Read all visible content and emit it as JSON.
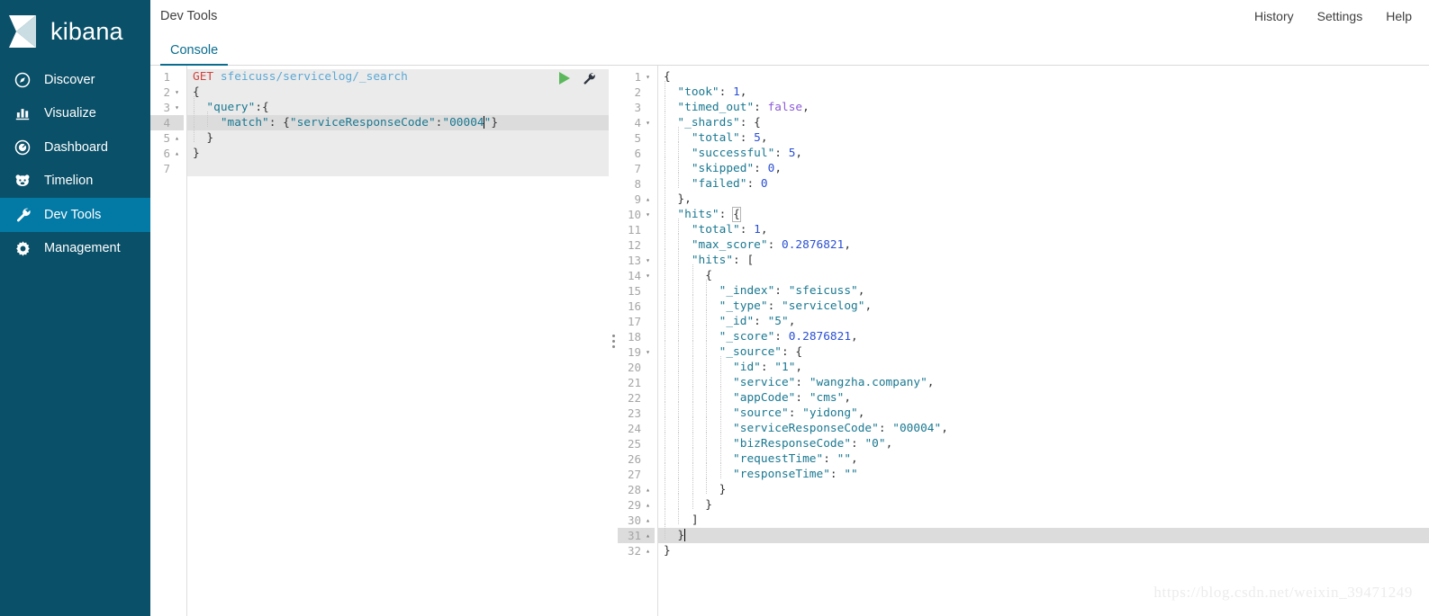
{
  "sidebar": {
    "brand": {
      "name": "kibana",
      "icon": "kibana-logo-icon"
    },
    "items": [
      {
        "label": "Discover",
        "icon": "compass-icon",
        "active": false
      },
      {
        "label": "Visualize",
        "icon": "bar-chart-icon",
        "active": false
      },
      {
        "label": "Dashboard",
        "icon": "gauge-icon",
        "active": false
      },
      {
        "label": "Timelion",
        "icon": "bear-icon",
        "active": false
      },
      {
        "label": "Dev Tools",
        "icon": "wrench-icon",
        "active": true
      },
      {
        "label": "Management",
        "icon": "gear-icon",
        "active": false
      }
    ]
  },
  "header": {
    "title": "Dev Tools",
    "links": [
      "History",
      "Settings",
      "Help"
    ]
  },
  "tabs": [
    {
      "label": "Console",
      "active": true
    }
  ],
  "request_editor": {
    "run_button": "run-request-play-icon",
    "wrench_button": "request-options-wrench-icon",
    "active_line": 4,
    "line_count": 7,
    "lines": [
      {
        "n": 1,
        "fold": "none",
        "tokens": [
          {
            "t": "GET ",
            "c": "tok-method"
          },
          {
            "t": "sfeicuss/servicelog/_search",
            "c": "tok-url"
          }
        ]
      },
      {
        "n": 2,
        "fold": "down",
        "tokens": [
          {
            "t": "{",
            "c": "tok-punct"
          }
        ]
      },
      {
        "n": 3,
        "fold": "down",
        "tokens": [
          {
            "t": "  \"query\"",
            "c": "tok-key"
          },
          {
            "t": ":{",
            "c": "tok-punct"
          }
        ]
      },
      {
        "n": 4,
        "fold": "none",
        "tokens": [
          {
            "t": "    \"match\"",
            "c": "tok-key"
          },
          {
            "t": ": {",
            "c": "tok-punct"
          },
          {
            "t": "\"serviceResponseCode\"",
            "c": "tok-key"
          },
          {
            "t": ":",
            "c": "tok-punct"
          },
          {
            "t": "\"00004",
            "c": "tok-str"
          },
          {
            "t": "|CARET|",
            "c": "caret"
          },
          {
            "t": "\"",
            "c": "tok-str"
          },
          {
            "t": "}",
            "c": "tok-punct"
          }
        ]
      },
      {
        "n": 5,
        "fold": "up",
        "tokens": [
          {
            "t": "  }",
            "c": "tok-punct"
          }
        ]
      },
      {
        "n": 6,
        "fold": "up",
        "tokens": [
          {
            "t": "}",
            "c": "tok-punct"
          }
        ]
      },
      {
        "n": 7,
        "fold": "none",
        "tokens": [
          {
            "t": "",
            "c": "tok-punct"
          }
        ]
      }
    ]
  },
  "response_editor": {
    "active_line": 31,
    "line_count": 32,
    "lines": [
      {
        "n": 1,
        "fold": "down",
        "tokens": [
          {
            "t": "{",
            "c": "tok-punct"
          }
        ]
      },
      {
        "n": 2,
        "fold": "none",
        "tokens": [
          {
            "t": "  \"took\"",
            "c": "tok-key"
          },
          {
            "t": ": ",
            "c": "tok-punct"
          },
          {
            "t": "1",
            "c": "tok-num"
          },
          {
            "t": ",",
            "c": "tok-punct"
          }
        ]
      },
      {
        "n": 3,
        "fold": "none",
        "tokens": [
          {
            "t": "  \"timed_out\"",
            "c": "tok-key"
          },
          {
            "t": ": ",
            "c": "tok-punct"
          },
          {
            "t": "false",
            "c": "tok-bool"
          },
          {
            "t": ",",
            "c": "tok-punct"
          }
        ]
      },
      {
        "n": 4,
        "fold": "down",
        "tokens": [
          {
            "t": "  \"_shards\"",
            "c": "tok-key"
          },
          {
            "t": ": {",
            "c": "tok-punct"
          }
        ]
      },
      {
        "n": 5,
        "fold": "none",
        "tokens": [
          {
            "t": "    \"total\"",
            "c": "tok-key"
          },
          {
            "t": ": ",
            "c": "tok-punct"
          },
          {
            "t": "5",
            "c": "tok-num"
          },
          {
            "t": ",",
            "c": "tok-punct"
          }
        ]
      },
      {
        "n": 6,
        "fold": "none",
        "tokens": [
          {
            "t": "    \"successful\"",
            "c": "tok-key"
          },
          {
            "t": ": ",
            "c": "tok-punct"
          },
          {
            "t": "5",
            "c": "tok-num"
          },
          {
            "t": ",",
            "c": "tok-punct"
          }
        ]
      },
      {
        "n": 7,
        "fold": "none",
        "tokens": [
          {
            "t": "    \"skipped\"",
            "c": "tok-key"
          },
          {
            "t": ": ",
            "c": "tok-punct"
          },
          {
            "t": "0",
            "c": "tok-num"
          },
          {
            "t": ",",
            "c": "tok-punct"
          }
        ]
      },
      {
        "n": 8,
        "fold": "none",
        "tokens": [
          {
            "t": "    \"failed\"",
            "c": "tok-key"
          },
          {
            "t": ": ",
            "c": "tok-punct"
          },
          {
            "t": "0",
            "c": "tok-num"
          }
        ]
      },
      {
        "n": 9,
        "fold": "up",
        "tokens": [
          {
            "t": "  },",
            "c": "tok-punct"
          }
        ]
      },
      {
        "n": 10,
        "fold": "down",
        "tokens": [
          {
            "t": "  \"hits\"",
            "c": "tok-key"
          },
          {
            "t": ": ",
            "c": "tok-punct"
          },
          {
            "t": "|BOX|",
            "c": "boxed"
          }
        ]
      },
      {
        "n": 11,
        "fold": "none",
        "tokens": [
          {
            "t": "    \"total\"",
            "c": "tok-key"
          },
          {
            "t": ": ",
            "c": "tok-punct"
          },
          {
            "t": "1",
            "c": "tok-num"
          },
          {
            "t": ",",
            "c": "tok-punct"
          }
        ]
      },
      {
        "n": 12,
        "fold": "none",
        "tokens": [
          {
            "t": "    \"max_score\"",
            "c": "tok-key"
          },
          {
            "t": ": ",
            "c": "tok-punct"
          },
          {
            "t": "0.2876821",
            "c": "tok-num"
          },
          {
            "t": ",",
            "c": "tok-punct"
          }
        ]
      },
      {
        "n": 13,
        "fold": "down",
        "tokens": [
          {
            "t": "    \"hits\"",
            "c": "tok-key"
          },
          {
            "t": ": [",
            "c": "tok-punct"
          }
        ]
      },
      {
        "n": 14,
        "fold": "down",
        "tokens": [
          {
            "t": "      {",
            "c": "tok-punct"
          }
        ]
      },
      {
        "n": 15,
        "fold": "none",
        "tokens": [
          {
            "t": "        \"_index\"",
            "c": "tok-key"
          },
          {
            "t": ": ",
            "c": "tok-punct"
          },
          {
            "t": "\"sfeicuss\"",
            "c": "tok-str"
          },
          {
            "t": ",",
            "c": "tok-punct"
          }
        ]
      },
      {
        "n": 16,
        "fold": "none",
        "tokens": [
          {
            "t": "        \"_type\"",
            "c": "tok-key"
          },
          {
            "t": ": ",
            "c": "tok-punct"
          },
          {
            "t": "\"servicelog\"",
            "c": "tok-str"
          },
          {
            "t": ",",
            "c": "tok-punct"
          }
        ]
      },
      {
        "n": 17,
        "fold": "none",
        "tokens": [
          {
            "t": "        \"_id\"",
            "c": "tok-key"
          },
          {
            "t": ": ",
            "c": "tok-punct"
          },
          {
            "t": "\"5\"",
            "c": "tok-str"
          },
          {
            "t": ",",
            "c": "tok-punct"
          }
        ]
      },
      {
        "n": 18,
        "fold": "none",
        "tokens": [
          {
            "t": "        \"_score\"",
            "c": "tok-key"
          },
          {
            "t": ": ",
            "c": "tok-punct"
          },
          {
            "t": "0.2876821",
            "c": "tok-num"
          },
          {
            "t": ",",
            "c": "tok-punct"
          }
        ]
      },
      {
        "n": 19,
        "fold": "down",
        "tokens": [
          {
            "t": "        \"_source\"",
            "c": "tok-key"
          },
          {
            "t": ": {",
            "c": "tok-punct"
          }
        ]
      },
      {
        "n": 20,
        "fold": "none",
        "tokens": [
          {
            "t": "          \"id\"",
            "c": "tok-key"
          },
          {
            "t": ": ",
            "c": "tok-punct"
          },
          {
            "t": "\"1\"",
            "c": "tok-str"
          },
          {
            "t": ",",
            "c": "tok-punct"
          }
        ]
      },
      {
        "n": 21,
        "fold": "none",
        "tokens": [
          {
            "t": "          \"service\"",
            "c": "tok-key"
          },
          {
            "t": ": ",
            "c": "tok-punct"
          },
          {
            "t": "\"wangzha.company\"",
            "c": "tok-str"
          },
          {
            "t": ",",
            "c": "tok-punct"
          }
        ]
      },
      {
        "n": 22,
        "fold": "none",
        "tokens": [
          {
            "t": "          \"appCode\"",
            "c": "tok-key"
          },
          {
            "t": ": ",
            "c": "tok-punct"
          },
          {
            "t": "\"cms\"",
            "c": "tok-str"
          },
          {
            "t": ",",
            "c": "tok-punct"
          }
        ]
      },
      {
        "n": 23,
        "fold": "none",
        "tokens": [
          {
            "t": "          \"source\"",
            "c": "tok-key"
          },
          {
            "t": ": ",
            "c": "tok-punct"
          },
          {
            "t": "\"yidong\"",
            "c": "tok-str"
          },
          {
            "t": ",",
            "c": "tok-punct"
          }
        ]
      },
      {
        "n": 24,
        "fold": "none",
        "tokens": [
          {
            "t": "          \"serviceResponseCode\"",
            "c": "tok-key"
          },
          {
            "t": ": ",
            "c": "tok-punct"
          },
          {
            "t": "\"00004\"",
            "c": "tok-str"
          },
          {
            "t": ",",
            "c": "tok-punct"
          }
        ]
      },
      {
        "n": 25,
        "fold": "none",
        "tokens": [
          {
            "t": "          \"bizResponseCode\"",
            "c": "tok-key"
          },
          {
            "t": ": ",
            "c": "tok-punct"
          },
          {
            "t": "\"0\"",
            "c": "tok-str"
          },
          {
            "t": ",",
            "c": "tok-punct"
          }
        ]
      },
      {
        "n": 26,
        "fold": "none",
        "tokens": [
          {
            "t": "          \"requestTime\"",
            "c": "tok-key"
          },
          {
            "t": ": ",
            "c": "tok-punct"
          },
          {
            "t": "\"\"",
            "c": "tok-str"
          },
          {
            "t": ",",
            "c": "tok-punct"
          }
        ]
      },
      {
        "n": 27,
        "fold": "none",
        "tokens": [
          {
            "t": "          \"responseTime\"",
            "c": "tok-key"
          },
          {
            "t": ": ",
            "c": "tok-punct"
          },
          {
            "t": "\"\"",
            "c": "tok-str"
          }
        ]
      },
      {
        "n": 28,
        "fold": "up",
        "tokens": [
          {
            "t": "        }",
            "c": "tok-punct"
          }
        ]
      },
      {
        "n": 29,
        "fold": "up",
        "tokens": [
          {
            "t": "      }",
            "c": "tok-punct"
          }
        ]
      },
      {
        "n": 30,
        "fold": "up",
        "tokens": [
          {
            "t": "    ]",
            "c": "tok-punct"
          }
        ]
      },
      {
        "n": 31,
        "fold": "up",
        "tokens": [
          {
            "t": "  }",
            "c": "tok-punct"
          },
          {
            "t": "|CARET|",
            "c": "caret"
          }
        ]
      },
      {
        "n": 32,
        "fold": "up",
        "tokens": [
          {
            "t": "}",
            "c": "tok-punct"
          }
        ]
      }
    ]
  },
  "watermark": "https://blog.csdn.net/weixin_39471249",
  "colors": {
    "sidebar_bg": "#0a5068",
    "sidebar_active": "#0379a5",
    "tab_accent": "#0a6d8f",
    "method": "#d0453d",
    "url": "#5ca8d4",
    "key": "#1a7891",
    "number": "#2a4fd4",
    "boolean": "#8d5bd6",
    "run_button": "#5cb85c",
    "active_line": "#dcdcdc",
    "request_bg": "#ebebeb"
  }
}
